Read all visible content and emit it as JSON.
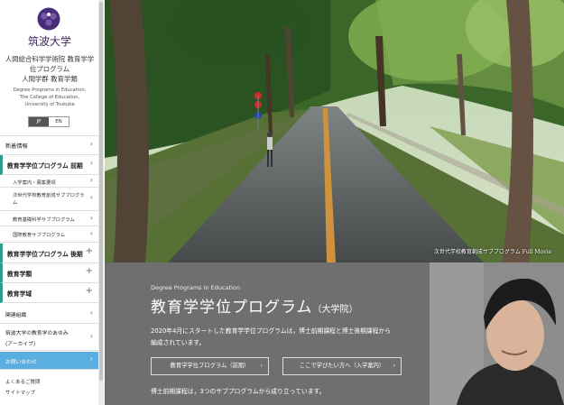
{
  "sidebar": {
    "university": "筑波大学",
    "faculty_lines": [
      "人間総合科学学術院 教育学学",
      "位プログラム",
      "人間学群 教育学類"
    ],
    "english_lines": [
      "Degree Programs in Education,",
      "The College of Education,",
      "University of Tsukuba"
    ],
    "lang": {
      "jp": "JP",
      "en": "EN"
    },
    "nav": {
      "news": "新着情報",
      "program_master": "教育学学位プログラム 前期",
      "sub1": "入学案内・募集要項",
      "sub2": "次世代学校教育創成サブプログラム",
      "sub3": "教育基礎科学サブプログラム",
      "sub4": "国際教育サブプログラム",
      "program_doctor": "教育学学位プログラム 後期",
      "college": "教育学類",
      "domain": "教育学域",
      "related": "関連組織",
      "history_1": "筑波大学の教育学のあゆみ",
      "history_2": "(アーカイブ)",
      "contact": "お問い合わせ",
      "faq": "よくあるご質問",
      "sitemap": "サイトマップ"
    },
    "arrows": {
      "chevron": "›",
      "plus": "+"
    }
  },
  "hero": {
    "caption": "次世代学校教育創成サブプログラム Full Movie"
  },
  "band": {
    "english": "Degree Programs in Education",
    "title": "教育学学位プログラム",
    "title_suffix": "（大学院）",
    "text_1": "2020年4月にスタートした教育学学位プログラムは，博士前期課程と博士後期課程から",
    "text_2": "編成されています。",
    "button_1": "教育学学位プログラム（前期）",
    "button_2": "ここで学びたい方へ（入学案内）",
    "footer": "博士前期課程は，3つのサブプログラムから成り立っています。"
  },
  "colors": {
    "accent": "#2a9d8f",
    "contact": "#5aaee0",
    "brand": "#3c2a5a"
  }
}
